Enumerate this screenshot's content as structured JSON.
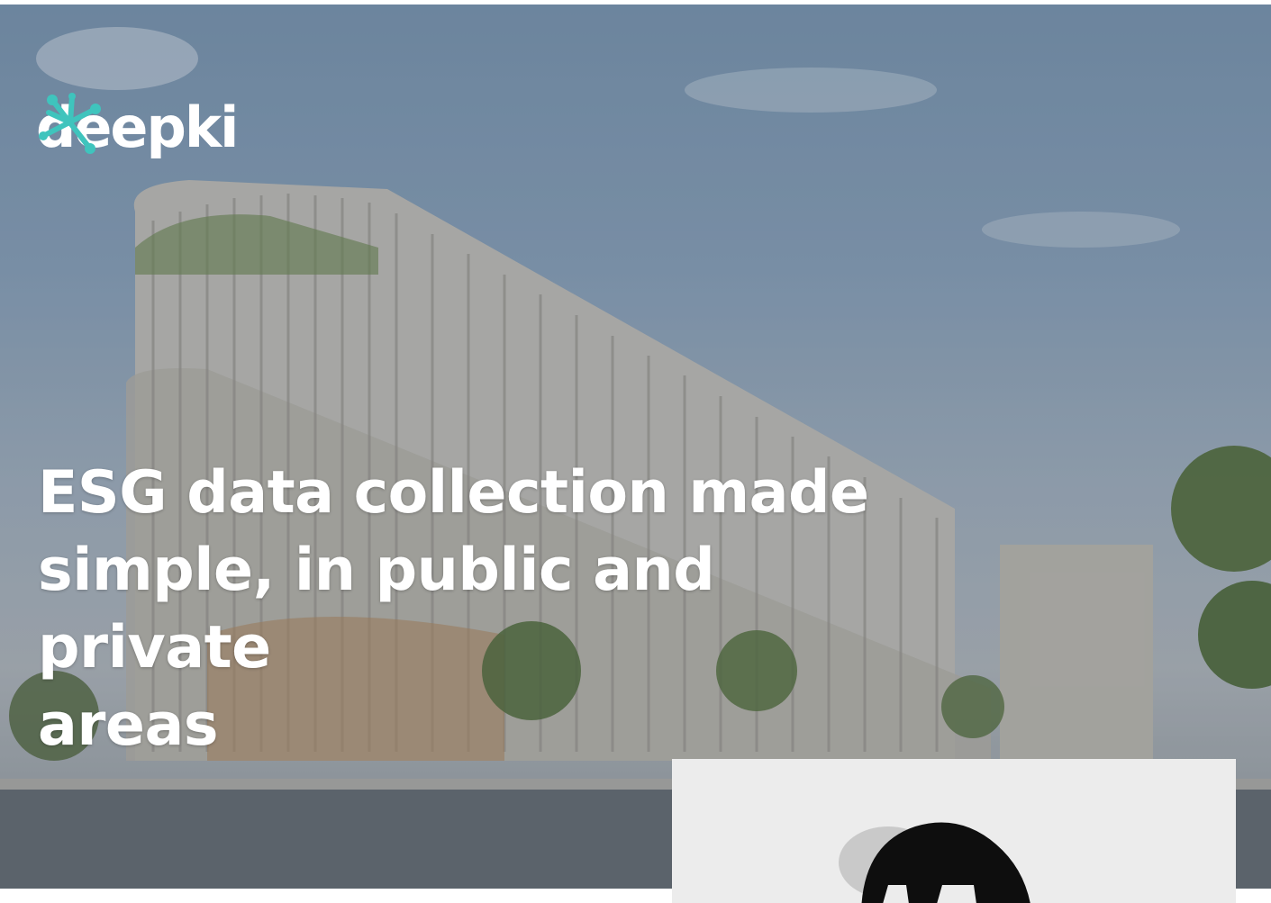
{
  "brand": {
    "name": "deepki",
    "accent_color": "#3fc4bd",
    "logo_icon": "network-star-icon"
  },
  "hero": {
    "headline_lines": [
      "ESG data collection made",
      "simple, in public and private",
      "areas"
    ],
    "background": "building-photo"
  },
  "badge": {
    "icon": "certification-badge-icon"
  }
}
